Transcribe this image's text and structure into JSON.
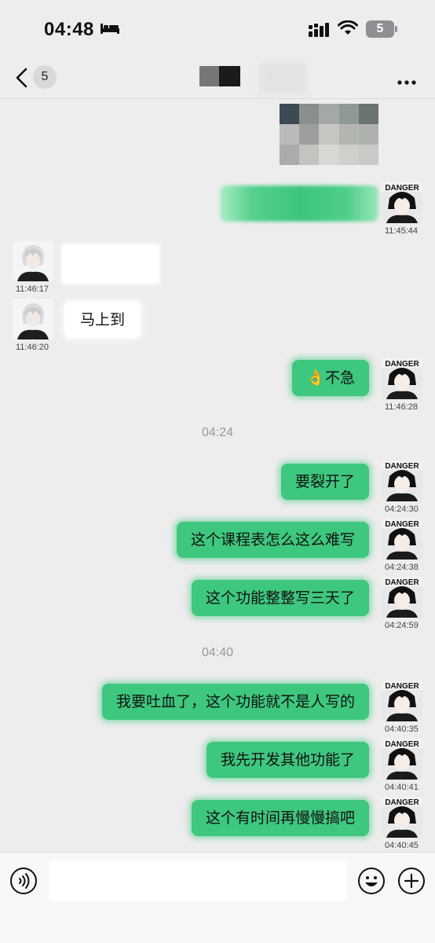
{
  "status_bar": {
    "time": "04:48",
    "battery": "5"
  },
  "nav": {
    "unread_count": "5"
  },
  "messages": [
    {
      "side": "right",
      "text": "",
      "time": "11:45:44",
      "blurred": true
    },
    {
      "side": "left",
      "text": "",
      "time": "11:46:17",
      "blurred": true
    },
    {
      "side": "left",
      "text": "马上到",
      "time": "11:46:20"
    },
    {
      "side": "right",
      "text": "👌不急",
      "time": "11:46:28"
    },
    {
      "side": "right",
      "text": "要裂开了",
      "time": "04:24:30"
    },
    {
      "side": "right",
      "text": "这个课程表怎么这么难写",
      "time": "04:24:38"
    },
    {
      "side": "right",
      "text": "这个功能整整写三天了",
      "time": "04:24:59"
    },
    {
      "side": "right",
      "text": "我要吐血了，这个功能就不是人写的",
      "time": "04:40:35"
    },
    {
      "side": "right",
      "text": "我先开发其他功能了",
      "time": "04:40:41"
    },
    {
      "side": "right",
      "text": "这个有时间再慢慢搞吧",
      "time": "04:40:45"
    }
  ],
  "separators": [
    "04:24",
    "04:40"
  ],
  "input": {
    "placeholder": ""
  },
  "colors": {
    "bubble_green": "#3ec77e",
    "background": "#ededed"
  },
  "icons": [
    "back-icon",
    "more-icon",
    "voice-icon",
    "emoji-icon",
    "plus-icon",
    "wifi-icon",
    "signal-icon",
    "bed-icon"
  ]
}
